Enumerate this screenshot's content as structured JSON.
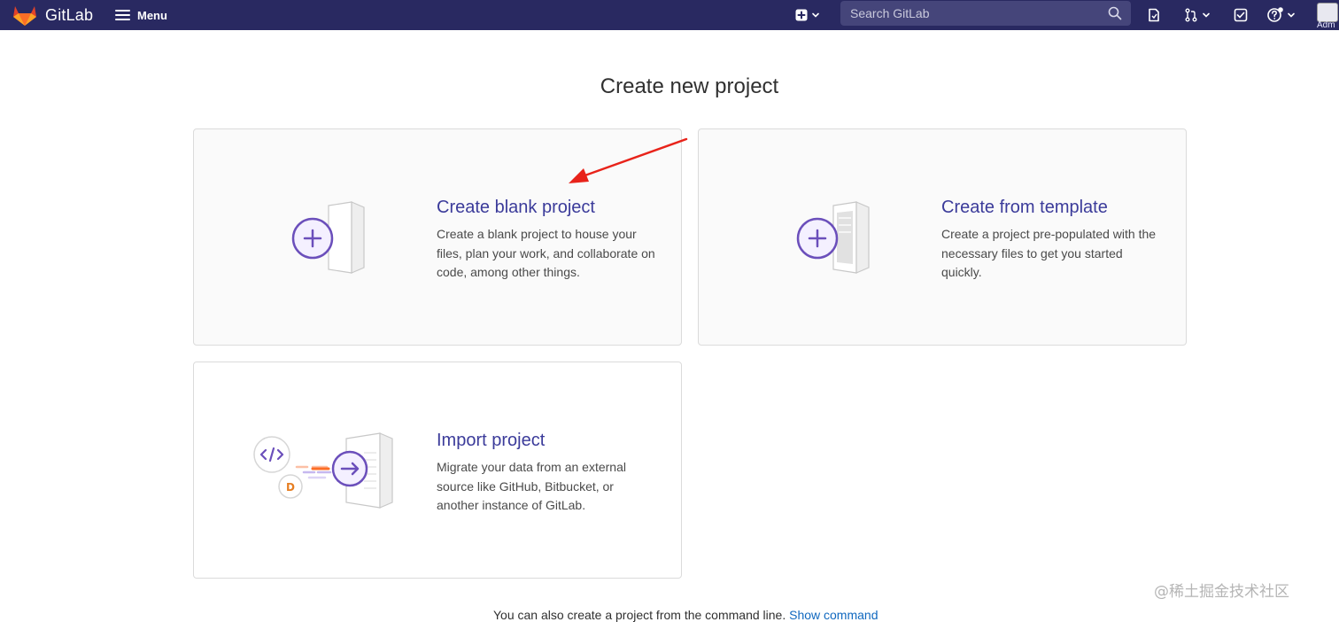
{
  "navbar": {
    "brand": "GitLab",
    "menu_label": "Menu",
    "search_placeholder": "Search GitLab",
    "avatar_label": "Adm",
    "icons": [
      "plus-square-icon",
      "search-icon",
      "issues-icon",
      "merge-request-icon",
      "todo-check-icon",
      "help-icon"
    ],
    "background_color": "#292961"
  },
  "main": {
    "title": "Create new project",
    "cards": [
      {
        "title": "Create blank project",
        "description": "Create a blank project to house your files, plan your work, and collaborate on code, among other things."
      },
      {
        "title": "Create from template",
        "description": "Create a project pre-populated with the necessary files to get you started quickly."
      },
      {
        "title": "Import project",
        "description": "Migrate your data from an external source like GitHub, Bitbucket, or another instance of GitLab."
      }
    ],
    "accent_color": "#6b4fbb",
    "link_color": "#3b3b9a"
  },
  "footer": {
    "text": "You can also create a project from the command line.",
    "link": "Show command"
  },
  "watermark": "@稀土掘金技术社区"
}
